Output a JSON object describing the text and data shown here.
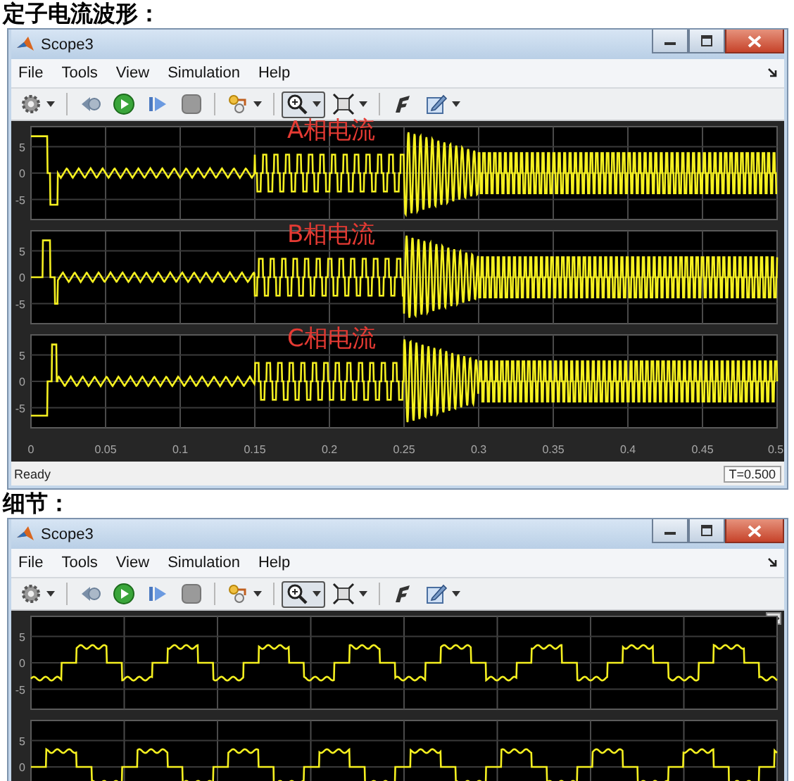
{
  "sections": [
    {
      "heading": "定子电流波形：",
      "window": {
        "title": "Scope3",
        "menu": [
          "File",
          "Tools",
          "View",
          "Simulation",
          "Help"
        ],
        "toolbar": [
          {
            "kind": "gear",
            "dropdown": true,
            "selected": false
          },
          {
            "kind": "back",
            "dropdown": false,
            "selected": false
          },
          {
            "kind": "run",
            "dropdown": false,
            "selected": false
          },
          {
            "kind": "forward",
            "dropdown": false,
            "selected": false
          },
          {
            "kind": "stop",
            "dropdown": false,
            "selected": false
          },
          {
            "kind": "highlight",
            "dropdown": true,
            "selected": false
          },
          {
            "kind": "zoom",
            "dropdown": true,
            "selected": true
          },
          {
            "kind": "fit",
            "dropdown": true,
            "selected": false
          },
          {
            "kind": "style",
            "dropdown": false,
            "selected": false
          },
          {
            "kind": "edit",
            "dropdown": true,
            "selected": false
          }
        ],
        "axes": [
          {
            "kind": "startup",
            "label": "A相电流",
            "yticks": [
              "5",
              "0",
              "-5"
            ]
          },
          {
            "kind": "startup",
            "label": "B相电流",
            "yticks": [
              "5",
              "0",
              "-5"
            ]
          },
          {
            "kind": "startup",
            "label": "C相电流",
            "yticks": [
              "5",
              "0",
              "-5"
            ]
          }
        ],
        "xticks": [
          "0",
          "0.05",
          "0.1",
          "0.15",
          "0.2",
          "0.25",
          "0.3",
          "0.35",
          "0.4",
          "0.45",
          "0.5"
        ],
        "status": "Ready",
        "time": "T=0.500"
      }
    },
    {
      "heading": "细节：",
      "window": {
        "title": "Scope3",
        "menu": [
          "File",
          "Tools",
          "View",
          "Simulation",
          "Help"
        ],
        "toolbar": [
          {
            "kind": "gear",
            "dropdown": true,
            "selected": false
          },
          {
            "kind": "back",
            "dropdown": false,
            "selected": false
          },
          {
            "kind": "run",
            "dropdown": false,
            "selected": false
          },
          {
            "kind": "forward",
            "dropdown": false,
            "selected": false
          },
          {
            "kind": "stop",
            "dropdown": false,
            "selected": false
          },
          {
            "kind": "highlight",
            "dropdown": true,
            "selected": false
          },
          {
            "kind": "zoom",
            "dropdown": true,
            "selected": true
          },
          {
            "kind": "fit",
            "dropdown": true,
            "selected": false
          },
          {
            "kind": "style",
            "dropdown": false,
            "selected": false
          },
          {
            "kind": "edit",
            "dropdown": true,
            "selected": false
          }
        ],
        "axes": [
          {
            "kind": "detail",
            "yticks": [
              "5",
              "0",
              "-5"
            ]
          },
          {
            "kind": "detail",
            "yticks": [
              "5",
              "0"
            ]
          }
        ]
      }
    }
  ]
}
